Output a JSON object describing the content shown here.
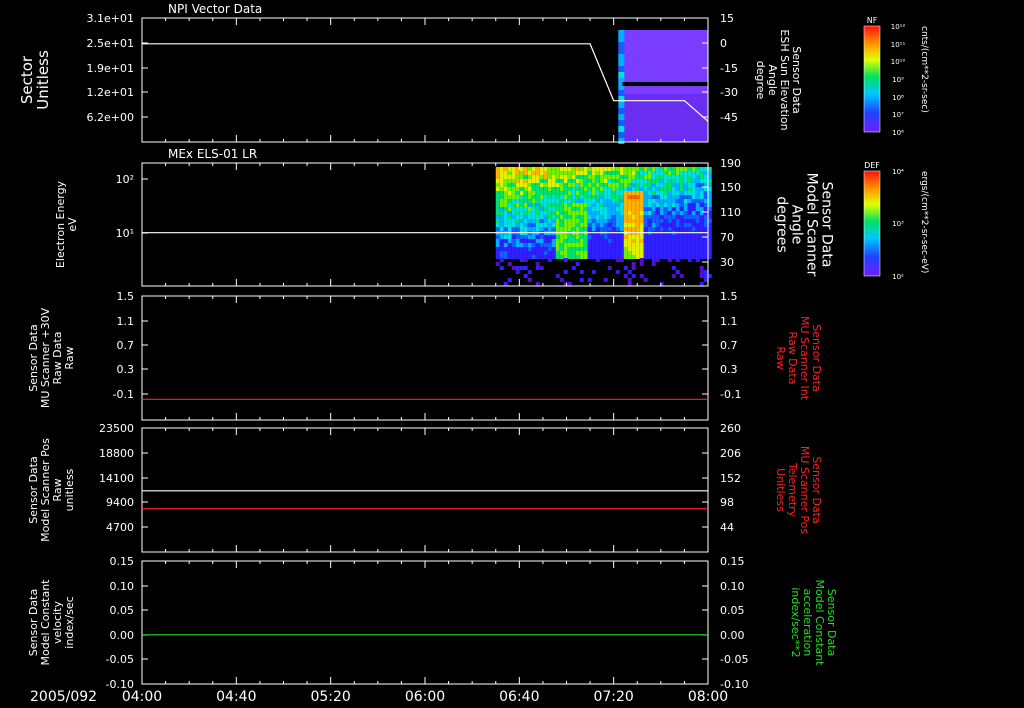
{
  "date_label": "2005/092",
  "x_ticks": [
    "04:00",
    "04:40",
    "05:20",
    "06:00",
    "06:40",
    "07:20",
    "08:00"
  ],
  "panels": [
    {
      "id": "p1",
      "title": "NPI Vector Data",
      "left_label": [
        "Sector",
        "Unitless"
      ],
      "left_ticks": [
        "3.1e+01",
        "2.5e+01",
        "1.9e+01",
        "1.2e+01",
        "6.2e+00"
      ],
      "right_label": [
        "Sensor Data",
        "ESH Sun Elevation",
        "Angle",
        "degree"
      ],
      "right_ticks": [
        "15",
        "0",
        "-15",
        "-30",
        "-45"
      ],
      "right_color": "#ffffff"
    },
    {
      "id": "p2",
      "title": "MEx ELS-01 LR",
      "left_label": [
        "Electron Energy",
        "eV"
      ],
      "left_ticks": [
        "10²",
        "10¹"
      ],
      "right_label": [
        "Sensor Data",
        "Model Scanner",
        "Angle",
        "degrees"
      ],
      "right_ticks": [
        "190",
        "150",
        "110",
        "70",
        "30"
      ],
      "right_color": "#ffffff"
    },
    {
      "id": "p3",
      "title": "",
      "left_label": [
        "Sensor Data",
        "MU Scanner +30V",
        "Raw Data",
        "Raw"
      ],
      "left_ticks": [
        "1.5",
        "1.1",
        "0.7",
        "0.3",
        "-0.1"
      ],
      "right_label": [
        "Sensor Data",
        "MU Scanner Int",
        "Raw Data",
        "Raw"
      ],
      "right_ticks": [
        "1.5",
        "1.1",
        "0.7",
        "0.3",
        "-0.1"
      ],
      "right_color": "#ff2020"
    },
    {
      "id": "p4",
      "title": "",
      "left_label": [
        "Sensor Data",
        "Model Scanner Pos",
        "Raw",
        "unitless"
      ],
      "left_ticks": [
        "23500",
        "18800",
        "14100",
        "9400",
        "4700"
      ],
      "right_label": [
        "Sensor Data",
        "MU Scanner Pos",
        "Telemetry",
        "Unitless"
      ],
      "right_ticks": [
        "260",
        "206",
        "152",
        "98",
        "44"
      ],
      "right_color": "#ff2020"
    },
    {
      "id": "p5",
      "title": "",
      "left_label": [
        "Sensor Data",
        "Model Constant",
        "velocity",
        "index/sec"
      ],
      "left_ticks": [
        "0.15",
        "0.10",
        "0.05",
        "0.00",
        "-0.05",
        "-0.10"
      ],
      "right_label": [
        "Sensor Data",
        "Model Constant",
        "acceleration",
        "index/sec**2"
      ],
      "right_ticks": [
        "0.15",
        "0.10",
        "0.05",
        "0.00",
        "-0.05",
        "-0.10"
      ],
      "right_color": "#20e020"
    }
  ],
  "colorbars": [
    {
      "id": "cb1",
      "title": "NF",
      "units": "cnts/(cm**2-sr-sec)",
      "ticks": [
        "10¹²",
        "10¹¹",
        "10¹⁰",
        "10⁹",
        "10⁸",
        "10⁷",
        "10⁶"
      ]
    },
    {
      "id": "cb2",
      "title": "DEF",
      "units": "ergs/(cm**2-sr-sec-eV)",
      "ticks": [
        "10⁴",
        "10³",
        "10²"
      ]
    }
  ],
  "chart_data": [
    {
      "type": "line",
      "panel": "NPI Vector Data",
      "x_range": [
        "04:00",
        "08:00"
      ],
      "series": [
        {
          "axis": "right",
          "color": "#ffffff",
          "x": [
            "04:00",
            "07:10",
            "07:20",
            "07:50",
            "08:00"
          ],
          "y": [
            0,
            0,
            -33,
            -33,
            -45
          ]
        }
      ],
      "spectrogram": {
        "start": "07:22",
        "end": "08:00",
        "colormap": "rainbow"
      },
      "ylim_left": [
        0,
        31
      ],
      "ylim_right": [
        -57,
        15
      ]
    },
    {
      "type": "heatmap",
      "panel": "MEx ELS-01 LR",
      "x_range": [
        "04:00",
        "08:00"
      ],
      "spectrogram": {
        "start": "06:30",
        "end": "08:00",
        "colormap": "rainbow"
      },
      "series": [
        {
          "axis": "right",
          "color": "#ffffff",
          "x": [
            "04:00",
            "08:00"
          ],
          "y": [
            88,
            88
          ]
        }
      ],
      "ylim_right": [
        10,
        190
      ]
    },
    {
      "type": "line",
      "panel": "p3",
      "x_range": [
        "04:00",
        "08:00"
      ],
      "series": [
        {
          "axis": "left",
          "color": "#ff2020",
          "x": [
            "04:00",
            "08:00"
          ],
          "y": [
            0.0,
            0.0
          ]
        }
      ],
      "ylim": [
        -0.3,
        1.5
      ]
    },
    {
      "type": "line",
      "panel": "p4",
      "x_range": [
        "04:00",
        "08:00"
      ],
      "series": [
        {
          "axis": "left",
          "color": "#ffffff",
          "x": [
            "04:00",
            "08:00"
          ],
          "y": [
            11600,
            11600
          ]
        },
        {
          "axis": "left",
          "color": "#ff2020",
          "x": [
            "04:00",
            "08:00"
          ],
          "y": [
            8200,
            8200
          ]
        }
      ],
      "ylim": [
        0,
        23500
      ]
    },
    {
      "type": "line",
      "panel": "p5",
      "x_range": [
        "04:00",
        "08:00"
      ],
      "series": [
        {
          "axis": "left",
          "color": "#20e020",
          "x": [
            "04:00",
            "08:00"
          ],
          "y": [
            0.0,
            0.0
          ]
        }
      ],
      "ylim": [
        -0.1,
        0.15
      ]
    }
  ]
}
